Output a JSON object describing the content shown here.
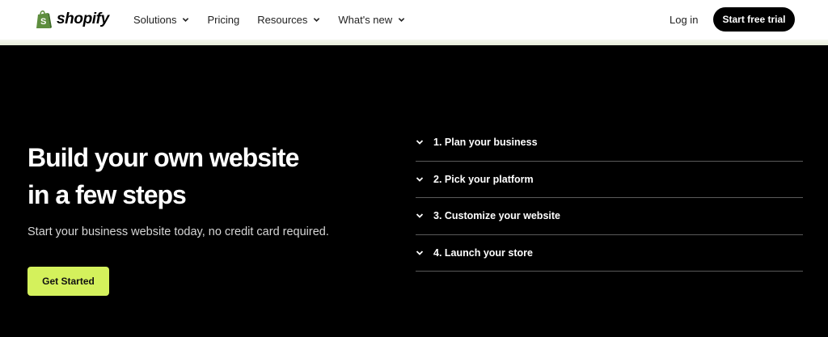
{
  "brand": {
    "name": "shopify",
    "logo_icon": "shopify-bag-icon",
    "accent": "#d4f15c",
    "logo_green": "#5e8e3e"
  },
  "nav": {
    "items": [
      {
        "label": "Solutions",
        "has_dropdown": true
      },
      {
        "label": "Pricing",
        "has_dropdown": false
      },
      {
        "label": "Resources",
        "has_dropdown": true
      },
      {
        "label": "What's new",
        "has_dropdown": true
      }
    ],
    "login_label": "Log in",
    "trial_label": "Start free trial"
  },
  "hero": {
    "title_line1": "Build your own website",
    "title_line2": "in a few steps",
    "subtitle": "Start your business website today, no credit card required.",
    "cta_label": "Get Started"
  },
  "steps": [
    {
      "label": "1. Plan your business"
    },
    {
      "label": "2. Pick your platform"
    },
    {
      "label": "3. Customize your website"
    },
    {
      "label": "4. Launch your store"
    }
  ]
}
